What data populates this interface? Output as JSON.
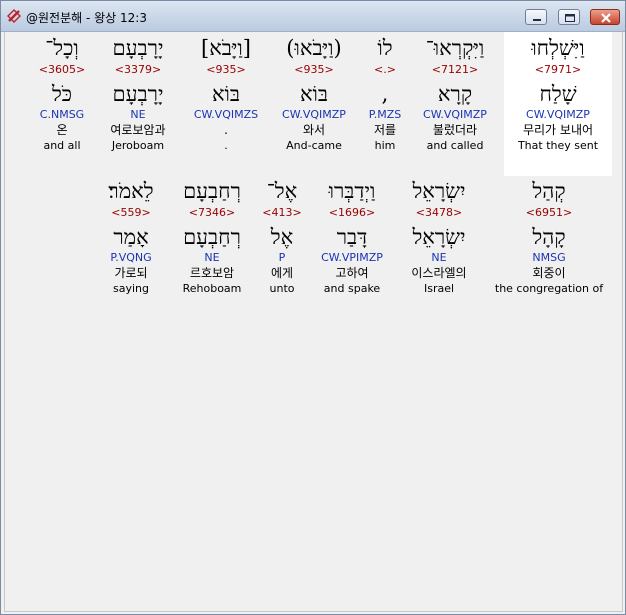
{
  "window": {
    "title": "@원전분해 - 왕상 12:3"
  },
  "row1": [
    {
      "heb": "וְכָל־",
      "num": "<3605>",
      "lemma": "כֹּל",
      "parse": "C.NMSG",
      "kor": "온",
      "eng": "and all"
    },
    {
      "heb": "יָרָבְעָם",
      "num": "<3379>",
      "lemma": "יָרָבְעָם",
      "parse": "NE",
      "kor": "여로보암과",
      "eng": "Jeroboam"
    },
    {
      "heb": "[וַיָּבֹא]",
      "num": "<935>",
      "lemma": "בּוֹא",
      "parse": "CW.VQIMZS",
      "kor": ".",
      "eng": "."
    },
    {
      "heb": "(וַיָּבֹאוּ)",
      "num": "<935>",
      "lemma": "בּוֹא",
      "parse": "CW.VQIMZP",
      "kor": "와서",
      "eng": "And-came"
    },
    {
      "heb": "לוֹ",
      "num": "<.>",
      "lemma": ",",
      "parse": "P.MZS",
      "kor": "저를",
      "eng": "him"
    },
    {
      "heb": "וַיִּקְרְאוּ־",
      "num": "<7121>",
      "lemma": "קָרָא",
      "parse": "CW.VQIMZP",
      "kor": "불렀더라",
      "eng": "and called"
    },
    {
      "heb": "וַיִּשְׁלְחוּ",
      "num": "<7971>",
      "lemma": "שָׁלַח",
      "parse": "CW.VQIMZP",
      "kor": "무리가 보내어",
      "eng": "That they sent"
    }
  ],
  "row2": [
    {
      "heb": "לֵאמֹר׃",
      "num": "<559>",
      "lemma": "אָמַר",
      "parse": "P.VQNG",
      "kor": "가로되",
      "eng": "saying"
    },
    {
      "heb": "רְחַבְעָם",
      "num": "<7346>",
      "lemma": "רְחַבְעָם",
      "parse": "NE",
      "kor": "르호보암",
      "eng": "Rehoboam"
    },
    {
      "heb": "אֶל־",
      "num": "<413>",
      "lemma": "אֶל",
      "parse": "P",
      "kor": "에게",
      "eng": "unto"
    },
    {
      "heb": "וַיְדַבְּרוּ",
      "num": "<1696>",
      "lemma": "דָּבַר",
      "parse": "CW.VPIMZP",
      "kor": "고하여",
      "eng": "and spake"
    },
    {
      "heb": "יִשְׂרָאֵל",
      "num": "<3478>",
      "lemma": "יִשְׂרָאֵל",
      "parse": "NE",
      "kor": "이스라엘의",
      "eng": "Israel"
    },
    {
      "heb": "קְהַל",
      "num": "<6951>",
      "lemma": "קָהָל",
      "parse": "NMSG",
      "kor": "회중이",
      "eng": "the congregation of"
    }
  ],
  "icons": {
    "app": "app-logo-icon",
    "minimize": "minimize-icon",
    "maximize": "maximize-icon",
    "close": "close-icon"
  },
  "colors": {
    "strongs": "#990000",
    "parse": "#1a34b3",
    "highlight": "#ffffff"
  }
}
